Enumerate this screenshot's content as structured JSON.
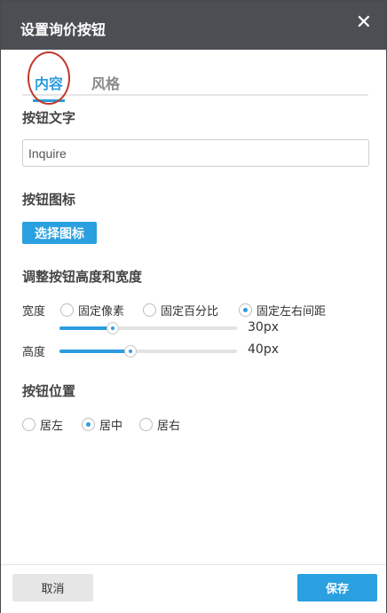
{
  "dialog": {
    "title": "设置询价按钮",
    "close_symbol": "✕"
  },
  "tabs": [
    {
      "label": "内容",
      "active": true
    },
    {
      "label": "风格",
      "active": false
    }
  ],
  "button_text": {
    "section_title": "按钮文字",
    "value": "Inquire"
  },
  "button_icon": {
    "section_title": "按钮图标",
    "choose_label": "选择图标"
  },
  "size": {
    "section_title": "调整按钮高度和宽度",
    "width_label": "宽度",
    "width_options": [
      {
        "label": "固定像素",
        "selected": false
      },
      {
        "label": "固定百分比",
        "selected": false
      },
      {
        "label": "固定左右间距",
        "selected": true
      }
    ],
    "width_value": "30px",
    "width_slider_fraction": 0.3,
    "height_label": "高度",
    "height_value": "40px",
    "height_slider_fraction": 0.4
  },
  "position": {
    "section_title": "按钮位置",
    "options": [
      {
        "label": "居左",
        "selected": false
      },
      {
        "label": "居中",
        "selected": true
      },
      {
        "label": "居右",
        "selected": false
      }
    ]
  },
  "footer": {
    "cancel_label": "取消",
    "save_label": "保存"
  },
  "colors": {
    "accent": "#2aa0e0",
    "titlebar": "#4b4e53",
    "annotation_ring": "#c0392b"
  }
}
